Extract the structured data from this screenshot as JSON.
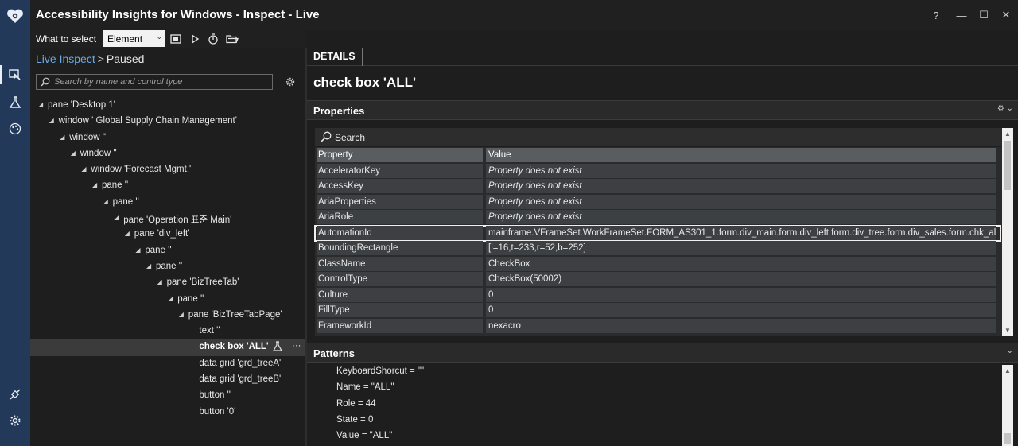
{
  "window": {
    "title": "Accessibility Insights for Windows - Inspect - Live",
    "controls": [
      "?",
      "—",
      "☐",
      "✕"
    ]
  },
  "toolbar": {
    "select_label": "What to select",
    "select_value": "Element"
  },
  "breadcrumb": {
    "live_inspect": "Live Inspect",
    "separator": ">",
    "state": "Paused"
  },
  "tree_search": {
    "placeholder": "Search by name and control type"
  },
  "tree": {
    "nodes": [
      {
        "label": "pane 'Desktop 1'"
      },
      {
        "label": "window '   Global Supply Chain Management'"
      },
      {
        "label": "window ''"
      },
      {
        "label": "window ''"
      },
      {
        "label": "window 'Forecast Mgmt.'"
      },
      {
        "label": "pane ''"
      },
      {
        "label": "pane ''"
      },
      {
        "label": "pane 'Operation 표준 Main'"
      },
      {
        "label": "pane 'div_left'"
      },
      {
        "label": "pane ''"
      },
      {
        "label": "pane ''"
      },
      {
        "label": "pane 'BizTreeTab'"
      },
      {
        "label": "pane ''"
      },
      {
        "label": "pane 'BizTreeTabPage'"
      },
      {
        "label": "text ''"
      },
      {
        "label": "check box 'ALL'",
        "more": "···"
      },
      {
        "label": "data grid 'grd_treeA'"
      },
      {
        "label": "data grid 'grd_treeB'"
      },
      {
        "label": "button ''"
      },
      {
        "label": "button '0'"
      }
    ]
  },
  "details": {
    "tab_label": "DETAILS",
    "element_title": "check box 'ALL'",
    "properties_header": "Properties",
    "search_label": "Search",
    "col_property": "Property",
    "col_value": "Value",
    "rows": [
      {
        "property": "AcceleratorKey",
        "value": "Property does not exist"
      },
      {
        "property": "AccessKey",
        "value": "Property does not exist"
      },
      {
        "property": "AriaProperties",
        "value": "Property does not exist"
      },
      {
        "property": "AriaRole",
        "value": "Property does not exist"
      },
      {
        "property": "AutomationId",
        "value": "mainframe.VFrameSet.WorkFrameSet.FORM_AS301_1.form.div_main.form.div_left.form.div_tree.form.div_sales.form.chk_all"
      },
      {
        "property": "BoundingRectangle",
        "value": "[l=16,t=233,r=52,b=252]"
      },
      {
        "property": "ClassName",
        "value": "CheckBox"
      },
      {
        "property": "ControlType",
        "value": "CheckBox(50002)"
      },
      {
        "property": "Culture",
        "value": "0"
      },
      {
        "property": "FillType",
        "value": "0"
      },
      {
        "property": "FrameworkId",
        "value": "nexacro"
      }
    ],
    "patterns_header": "Patterns",
    "patterns": [
      "KeyboardShorcut = \"\"",
      "Name = \"ALL\"",
      "Role = 44",
      "State = 0",
      "Value = \"ALL\""
    ]
  }
}
